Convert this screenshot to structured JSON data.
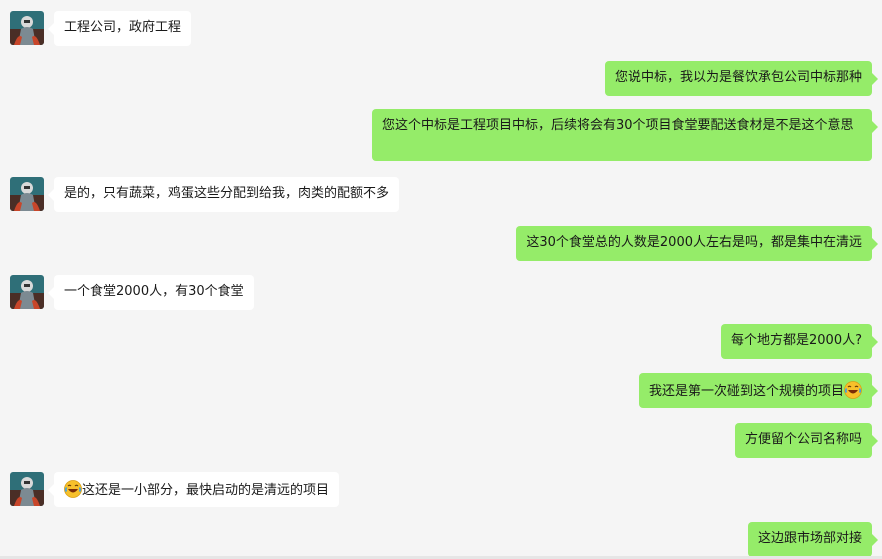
{
  "conversation": {
    "messages": [
      {
        "id": 1,
        "side": "left",
        "text": "工程公司，政府工程"
      },
      {
        "id": 2,
        "side": "right",
        "text": "您说中标，我以为是餐饮承包公司中标那种"
      },
      {
        "id": 3,
        "side": "right",
        "text": "您这个中标是工程项目中标，后续将会有30个项目食堂要配送食材是不是这个意思"
      },
      {
        "id": 4,
        "side": "left",
        "text": "是的，只有蔬菜，鸡蛋这些分配到给我，肉类的配额不多"
      },
      {
        "id": 5,
        "side": "right",
        "text": "这30个食堂总的人数是2000人左右是吗，都是集中在清远"
      },
      {
        "id": 6,
        "side": "left",
        "text": "一个食堂2000人，有30个食堂"
      },
      {
        "id": 7,
        "side": "right",
        "text": "每个地方都是2000人?"
      },
      {
        "id": 8,
        "side": "right",
        "text": "我还是第一次碰到这个规模的项目",
        "emoji_after": "laugh-cry-emoji"
      },
      {
        "id": 9,
        "side": "right",
        "text": "方便留个公司名称吗"
      },
      {
        "id": 10,
        "side": "left",
        "text": "这还是一小部分，最快启动的是清远的项目",
        "emoji_before": "laugh-cry-emoji"
      },
      {
        "id": 11,
        "side": "right",
        "text": "这边跟市场部对接"
      }
    ]
  },
  "colors": {
    "background": "#f5f5f5",
    "incoming_bubble": "#ffffff",
    "outgoing_bubble": "#95ec69",
    "text": "#191919"
  }
}
